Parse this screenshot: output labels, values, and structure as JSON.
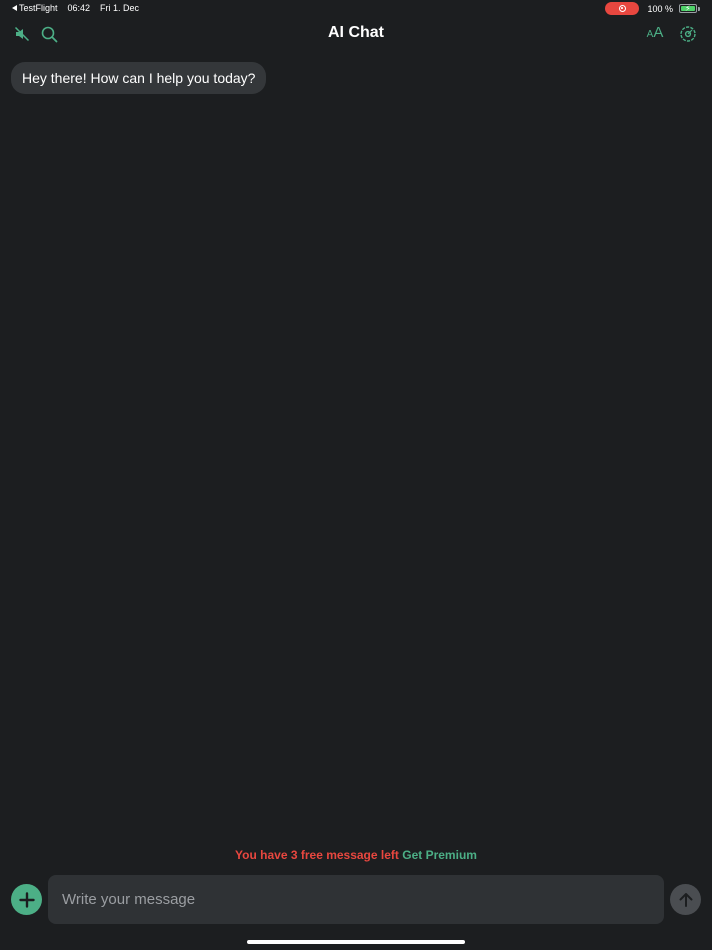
{
  "status_bar": {
    "back_app": "TestFlight",
    "time": "06:42",
    "date": "Fri 1. Dec",
    "battery": "100 %",
    "battery_level": 1.0,
    "recording_icon": "screen-record-icon"
  },
  "nav": {
    "title": "AI Chat",
    "left_icons": [
      "mute-icon",
      "search-icon"
    ],
    "right_icons": [
      "font-size-icon",
      "settings-icon"
    ],
    "accent_color": "#4caf86"
  },
  "messages": [
    {
      "role": "assistant",
      "text": "Hey there! How can I help you today?"
    }
  ],
  "notice": {
    "warning": "You have 3 free message left",
    "cta": "Get Premium",
    "warning_color": "#e8473f",
    "cta_color": "#4caf86"
  },
  "composer": {
    "placeholder": "Write your message",
    "value": "",
    "add_icon": "plus-icon",
    "send_icon": "arrow-up-icon"
  },
  "colors": {
    "background": "#1c1e20",
    "bubble": "#34373a",
    "input": "#2f3235"
  }
}
